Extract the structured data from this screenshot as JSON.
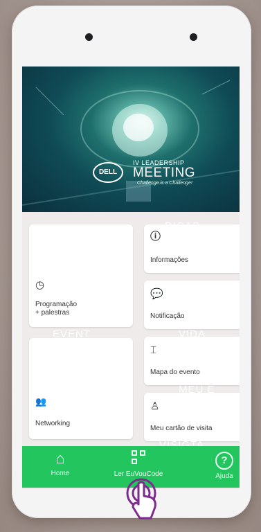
{
  "banner": {
    "logo_text": "DELL",
    "event_line1": "IV LEADERSHIP",
    "event_line2": "MEETING",
    "tagline": "Challenge is a Challenge!"
  },
  "tiles": {
    "informacoes": {
      "label": "Informações",
      "icon": "info-icon"
    },
    "programacao": {
      "label_line1": "Programação",
      "label_line2": "+ palestras",
      "icon": "clock-icon"
    },
    "notificacao": {
      "label": "Notificação",
      "icon": "chat-bubble-icon"
    },
    "mapa": {
      "label": "Mapa do evento",
      "icon": "map-icon"
    },
    "networking": {
      "label": "Networking",
      "icon": "people-icon"
    },
    "cartao": {
      "label": "Meu cartão de visita",
      "icon": "contact-card-icon"
    }
  },
  "overlay_words": {
    "dicas": "DICAS",
    "evento": "EVENT",
    "vida": "VIDA",
    "meu_e": "MEU E",
    "visita": "VISIGTA"
  },
  "nav": {
    "home": "Home",
    "ler_code": "Ler EuVouCode",
    "ajuda": "Ajuda",
    "help_glyph": "?"
  },
  "colors": {
    "nav_green": "#22c55e",
    "tile_bg": "#ffffff",
    "screen_bg": "#eeebea"
  }
}
